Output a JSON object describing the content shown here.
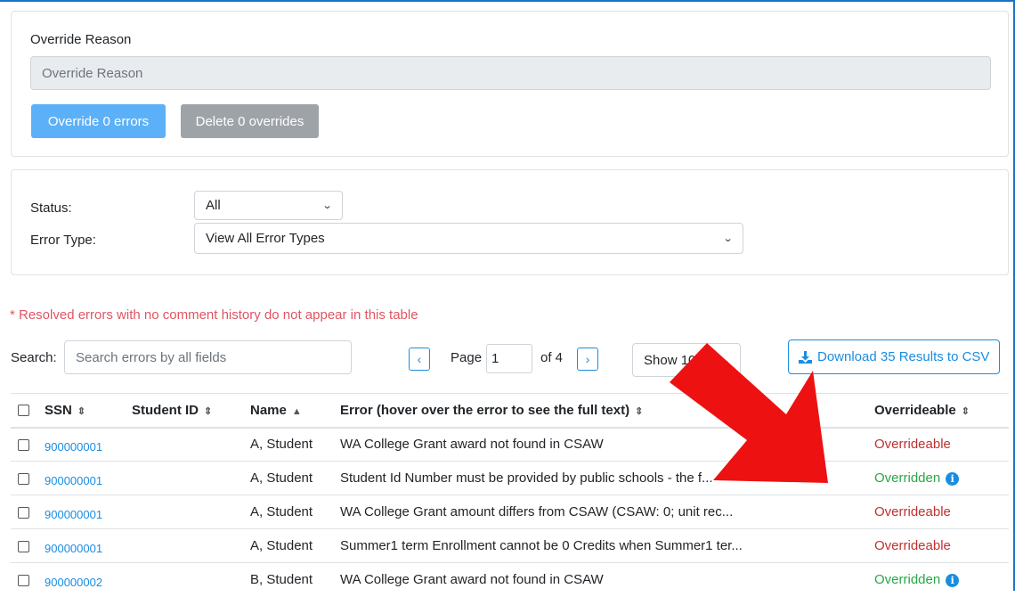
{
  "override_card": {
    "label": "Override Reason",
    "placeholder": "Override Reason",
    "override_button": "Override 0 errors",
    "delete_button": "Delete 0 overrides"
  },
  "filters": {
    "status_label": "Status:",
    "status_value": "All",
    "error_type_label": "Error Type:",
    "error_type_value": "View All Error Types"
  },
  "note": "* Resolved errors with no comment history do not appear in this table",
  "toolbar": {
    "search_label": "Search:",
    "search_placeholder": "Search errors by all fields",
    "page_label": "Page",
    "page_value": "1",
    "page_of": "of 4",
    "show_value": "Show 10",
    "download_label": "Download 35 Results to CSV"
  },
  "table": {
    "headers": {
      "ssn": "SSN",
      "student_id": "Student ID",
      "name": "Name",
      "error": "Error (hover over the error to see the full text)",
      "overrideable": "Overrideable"
    },
    "rows": [
      {
        "ssn": "900000001",
        "student_id": "",
        "name": "A, Student",
        "error": "WA College Grant award not found in CSAW",
        "status": "Overrideable",
        "status_type": "overrideable"
      },
      {
        "ssn": "900000001",
        "student_id": "",
        "name": "A, Student",
        "error": "Student Id Number must be provided by public schools - the f...",
        "status": "Overridden",
        "status_type": "overridden"
      },
      {
        "ssn": "900000001",
        "student_id": "",
        "name": "A, Student",
        "error": "WA College Grant amount differs from CSAW (CSAW: 0; unit rec...",
        "status": "Overrideable",
        "status_type": "overrideable"
      },
      {
        "ssn": "900000001",
        "student_id": "",
        "name": "A, Student",
        "error": "Summer1 term Enrollment cannot be 0 Credits when Summer1 ter...",
        "status": "Overrideable",
        "status_type": "overrideable"
      },
      {
        "ssn": "900000002",
        "student_id": "",
        "name": "B, Student",
        "error": "WA College Grant award not found in CSAW",
        "status": "Overridden",
        "status_type": "overridden"
      }
    ]
  },
  "colors": {
    "overrideable": "#c0302f",
    "overridden": "#28a745",
    "arrow": "#ee1111"
  }
}
